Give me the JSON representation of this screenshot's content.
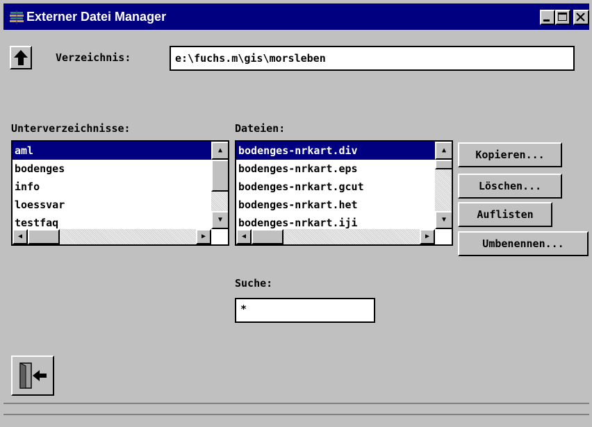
{
  "window": {
    "title": "Externer Datei Manager",
    "controls": {
      "minimize": "_",
      "maximize": "□",
      "close": "✕"
    }
  },
  "directory": {
    "label": "Verzeichnis:",
    "value": "e:\\fuchs.m\\gis\\morsleben",
    "up_icon": "up-arrow-icon"
  },
  "subdirectories": {
    "label": "Unterverzeichnisse:",
    "items": [
      "aml",
      "bodenges",
      "info",
      "loessvar",
      "testfaq"
    ],
    "selected": "aml"
  },
  "files": {
    "label": "Dateien:",
    "items": [
      "bodenges-nrkart.div",
      "bodenges-nrkart.eps",
      "bodenges-nrkart.gcut",
      "bodenges-nrkart.het",
      "bodenges-nrkart.iji"
    ],
    "selected": "bodenges-nrkart.div"
  },
  "actions": {
    "copy": "Kopieren...",
    "delete": "Löschen...",
    "list": "Auflisten",
    "rename": "Umbenennen..."
  },
  "search": {
    "label": "Suche:",
    "value": "*"
  },
  "exit_icon": "exit-door-icon",
  "colors": {
    "titlebar": "#000080",
    "face": "#c0c0c0",
    "selection": "#000080"
  }
}
